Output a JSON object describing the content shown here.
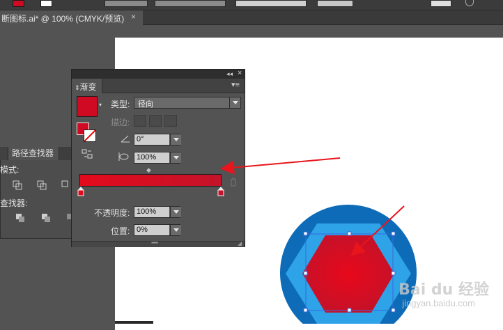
{
  "doc_tab": {
    "title": "断图标.ai* @ 100% (CMYK/预览)",
    "close_glyph": "×"
  },
  "colors": {
    "gradient_start": "#e30a1c",
    "gradient_end": "#c4132a",
    "fill_swatch": "#cf0a22",
    "circle": "#0d6bb8",
    "hexagon_outline": "#2ea3e8",
    "annotation_arrow": "#e8151c",
    "selection": "#3867e0"
  },
  "gradient_panel": {
    "tab_label": "渐变",
    "type_label": "类型:",
    "type_value": "径向",
    "stroke_label": "描边:",
    "angle_value": "0°",
    "aspect_value": "100%",
    "opacity_label": "不透明度:",
    "opacity_value": "100%",
    "location_label": "位置:",
    "location_value": "0%",
    "angle_icon": "angle-icon",
    "aspect_icon": "aspect-ratio-icon",
    "reverse_icon": "reverse-gradient-icon",
    "delete_stop_icon": "trash-icon"
  },
  "pathfinder_panel": {
    "tab_label": "路径查找器",
    "shape_modes_label": "模式:",
    "pathfinders_label": "查找器:"
  },
  "watermark": {
    "brand": "Bai du 经验",
    "url": "jingyan.baidu.com"
  }
}
